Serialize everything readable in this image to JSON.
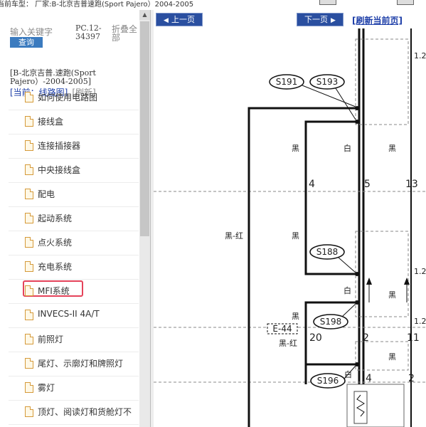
{
  "topbar": {
    "text": "当前车型： 厂家:B-北京吉普速跑(Sport Pajero）2004-2005"
  },
  "sidebar": {
    "search_placeholder": "输入关键字",
    "query_button": "查询",
    "pc_code": "PC.12-34397",
    "fold_all": "折叠全部",
    "model_title": "[B-北京吉普.速跑(Sport Pajero）-2004-2005]",
    "current_label": "[当前：线路图]",
    "refresh_label": "[刷新]",
    "items": [
      {
        "label": "如何使用电路图"
      },
      {
        "label": "接线盒"
      },
      {
        "label": "连接插接器"
      },
      {
        "label": "中央接线盒"
      },
      {
        "label": "配电"
      },
      {
        "label": "起动系统"
      },
      {
        "label": "点火系统"
      },
      {
        "label": "充电系统"
      },
      {
        "label": "MFI系统"
      },
      {
        "label": "INVECS-II 4A/T"
      },
      {
        "label": "前照灯"
      },
      {
        "label": "尾灯、示廓灯和牌照灯"
      },
      {
        "label": "雾灯"
      },
      {
        "label": "顶灯、阅读灯和货舱灯不"
      }
    ]
  },
  "toolbar": {
    "prev_label": "上一页",
    "next_label": "下一页",
    "refresh_page_label": "[刷新当前页]"
  },
  "diagram": {
    "connectors": [
      {
        "label": "S191"
      },
      {
        "label": "S193"
      },
      {
        "label": "S188"
      },
      {
        "label": "S198"
      },
      {
        "label": "S196"
      },
      {
        "label": "E-44"
      }
    ],
    "wire_colors": {
      "black": "黑",
      "white": "白",
      "black_red": "黑-红"
    },
    "pin_numbers": {
      "p4a": "4",
      "p5": "5",
      "p13": "13",
      "p20": "20",
      "p2a": "2",
      "p11": "11",
      "p4b": "4",
      "p2b": "2"
    },
    "edge_labels": {
      "e1": "1.2",
      "e2": "1.2",
      "e3": "1.2"
    }
  }
}
